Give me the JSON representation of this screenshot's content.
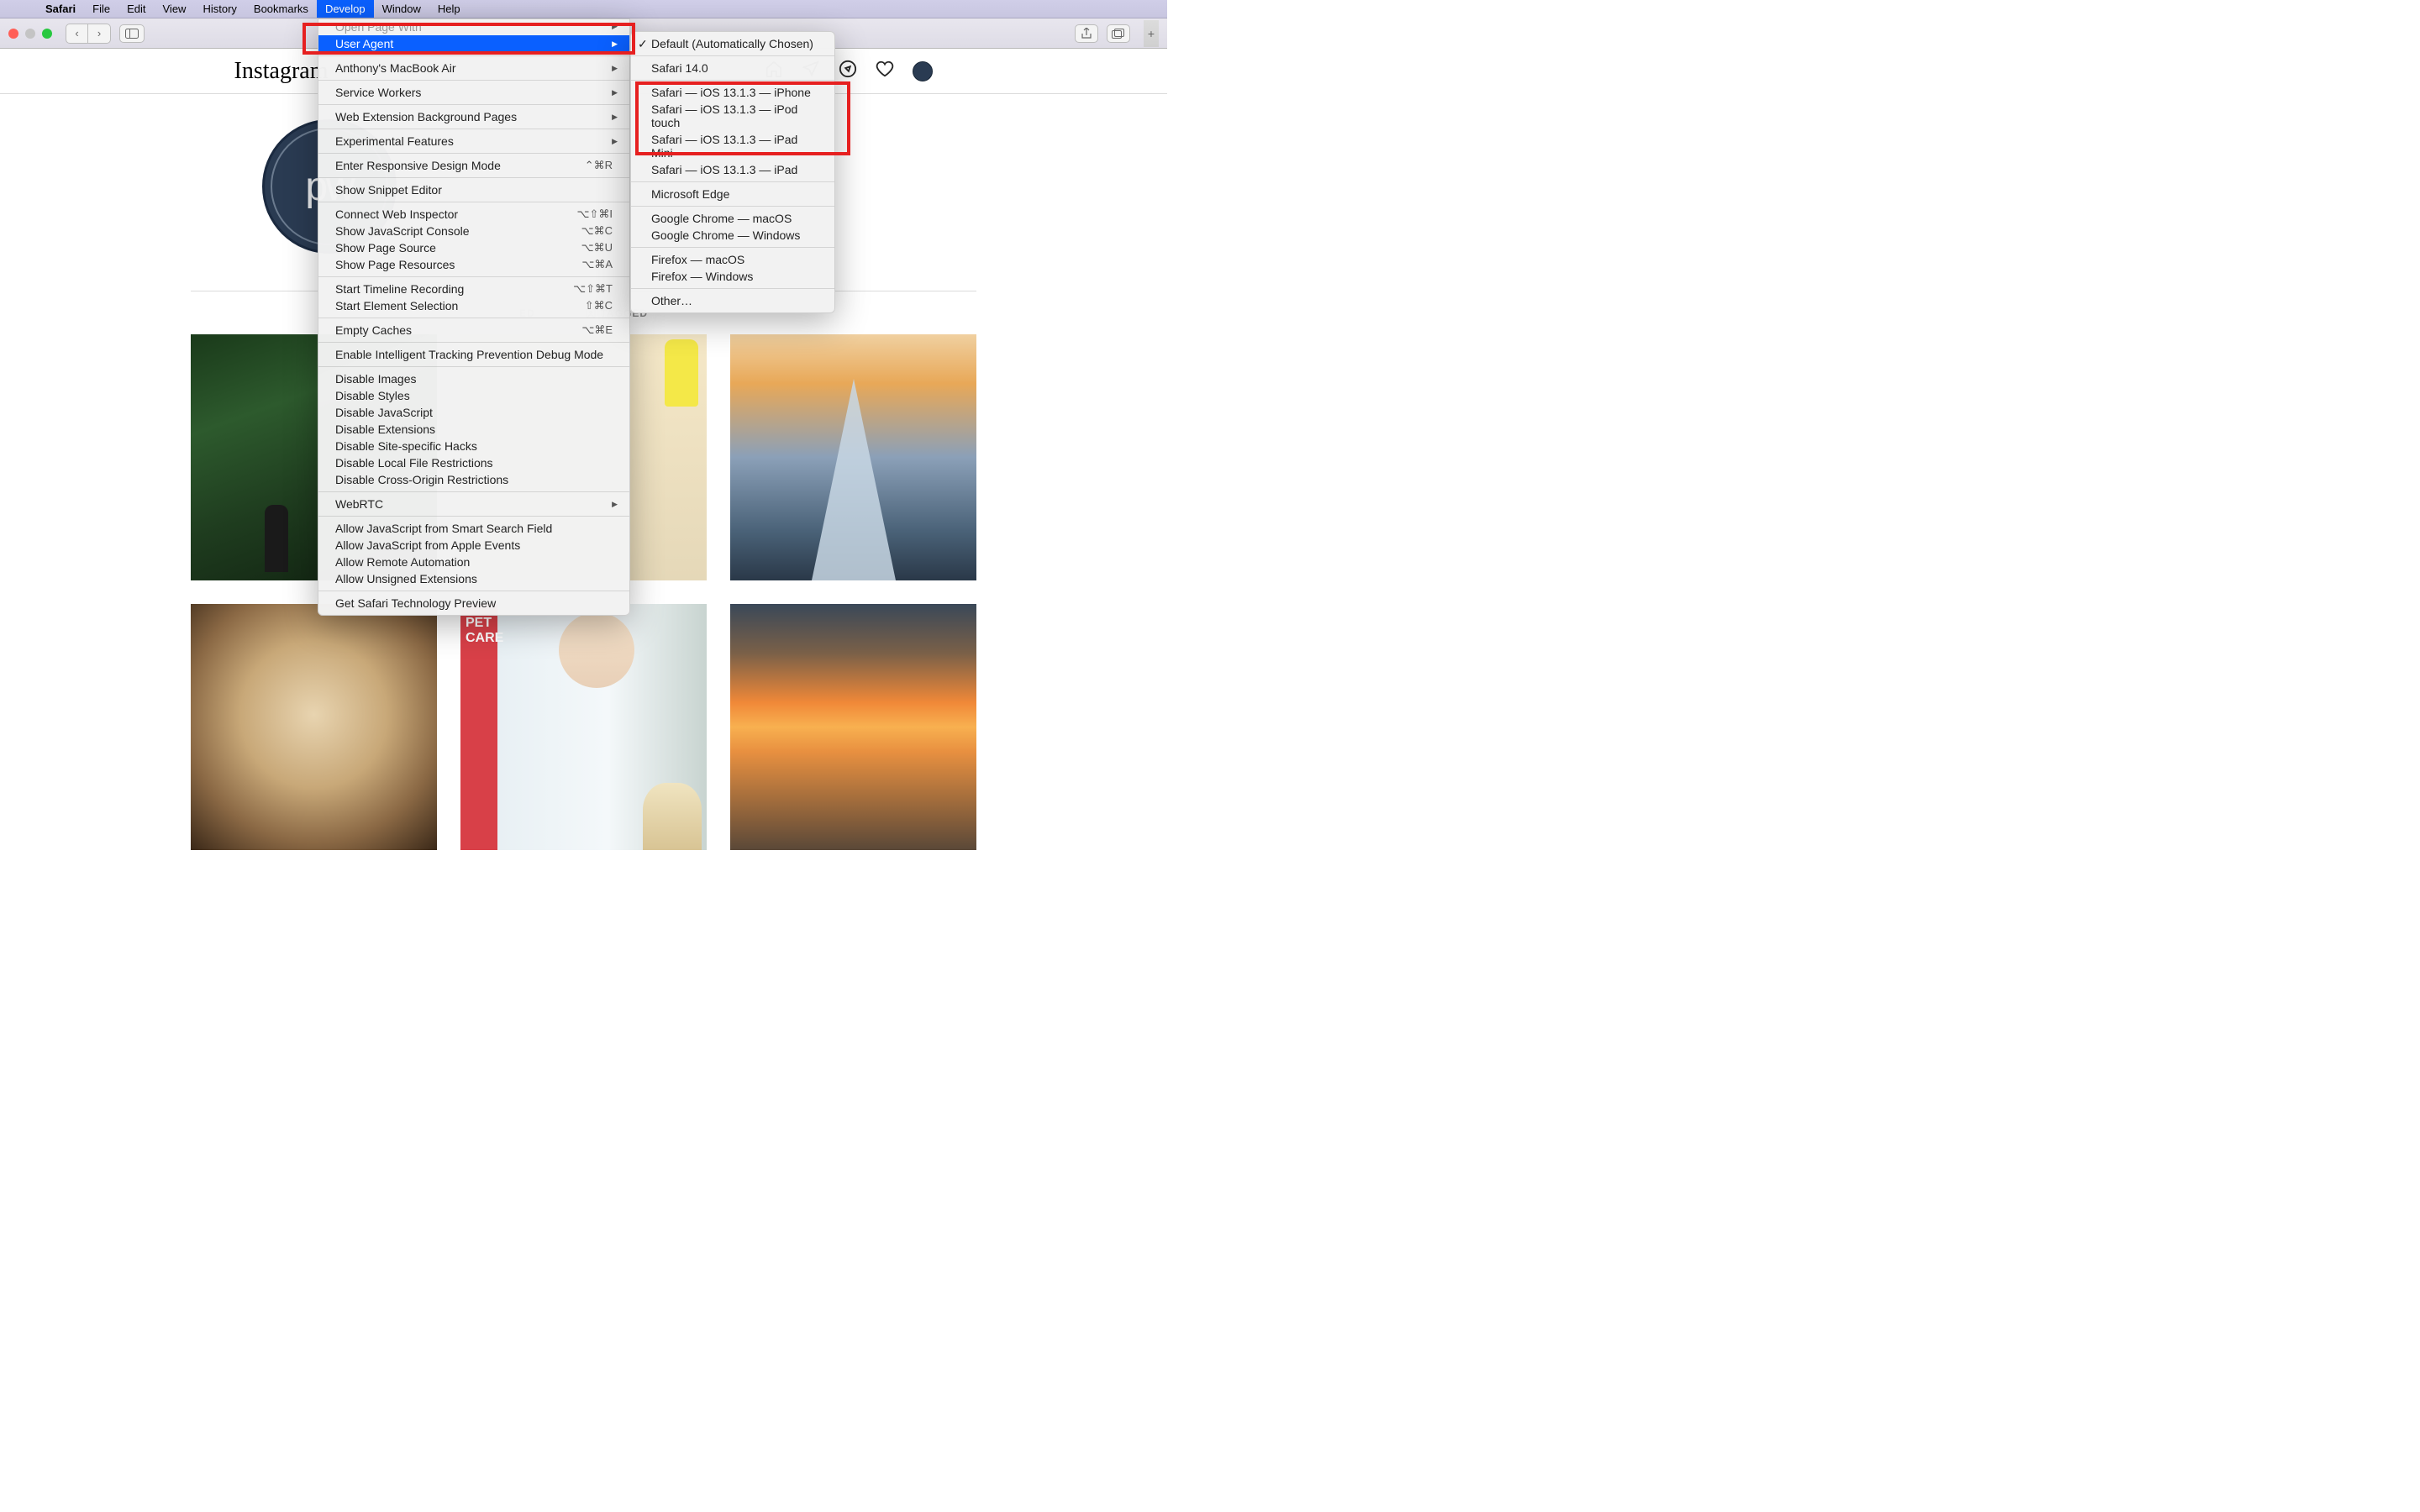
{
  "menubar": {
    "app": "Safari",
    "items": [
      "File",
      "Edit",
      "View",
      "History",
      "Bookmarks",
      "Develop",
      "Window",
      "Help"
    ],
    "active_index": 5
  },
  "develop_menu": {
    "items_top_cutoff": "Open Page With",
    "user_agent": "User Agent",
    "device": "Anthony's MacBook Air",
    "service_workers": "Service Workers",
    "web_ext_bg": "Web Extension Background Pages",
    "experimental": "Experimental Features",
    "responsive": "Enter Responsive Design Mode",
    "responsive_sc": "⌃⌘R",
    "snippet": "Show Snippet Editor",
    "connect_wi": "Connect Web Inspector",
    "connect_wi_sc": "⌥⇧⌘I",
    "js_console": "Show JavaScript Console",
    "js_console_sc": "⌥⌘C",
    "page_source": "Show Page Source",
    "page_source_sc": "⌥⌘U",
    "page_resources": "Show Page Resources",
    "page_resources_sc": "⌥⌘A",
    "timeline": "Start Timeline Recording",
    "timeline_sc": "⌥⇧⌘T",
    "element_sel": "Start Element Selection",
    "element_sel_sc": "⇧⌘C",
    "empty_caches": "Empty Caches",
    "empty_caches_sc": "⌥⌘E",
    "itp_debug": "Enable Intelligent Tracking Prevention Debug Mode",
    "disable_images": "Disable Images",
    "disable_styles": "Disable Styles",
    "disable_js": "Disable JavaScript",
    "disable_ext": "Disable Extensions",
    "disable_site_hacks": "Disable Site-specific Hacks",
    "disable_local_file": "Disable Local File Restrictions",
    "disable_cors": "Disable Cross-Origin Restrictions",
    "webrtc": "WebRTC",
    "allow_js_smart": "Allow JavaScript from Smart Search Field",
    "allow_js_apple": "Allow JavaScript from Apple Events",
    "allow_remote": "Allow Remote Automation",
    "allow_unsigned": "Allow Unsigned Extensions",
    "get_stp": "Get Safari Technology Preview"
  },
  "user_agent_submenu": {
    "default": "Default (Automatically Chosen)",
    "safari14": "Safari 14.0",
    "ios_iphone": "Safari — iOS 13.1.3 — iPhone",
    "ios_ipod": "Safari — iOS 13.1.3 — iPod touch",
    "ios_ipadmini": "Safari — iOS 13.1.3 — iPad Mini",
    "ios_ipad": "Safari — iOS 13.1.3 — iPad",
    "edge": "Microsoft Edge",
    "chrome_mac": "Google Chrome — macOS",
    "chrome_win": "Google Chrome — Windows",
    "firefox_mac": "Firefox — macOS",
    "firefox_win": "Firefox — Windows",
    "other": "Other…"
  },
  "instagram": {
    "logo": "Instagram",
    "avatar_text": "pw",
    "tab_tagged": "TAGGED",
    "tab_posts_partial": "ED"
  },
  "post5": {
    "line1": "PET",
    "line2": "CARE"
  }
}
